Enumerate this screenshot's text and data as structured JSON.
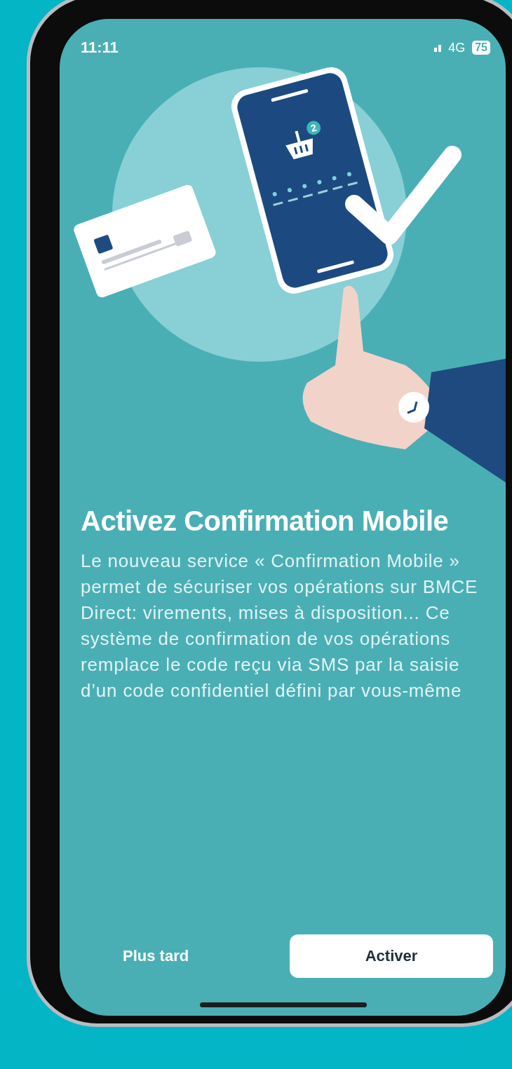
{
  "status_bar": {
    "time": "11:11",
    "network": "4G",
    "battery": "75"
  },
  "illustration": {
    "badge": "2"
  },
  "title": "Activez Confirmation Mobile",
  "description": "Le nouveau service « Confirmation Mobile » permet de sécuriser vos opérations sur BMCE Direct: virements, mises à disposition... Ce système de confirmation de vos opérations remplace le code reçu via SMS par la saisie d’un code confidentiel défini par vous-même",
  "buttons": [
    {
      "label": "Plus tard",
      "kind": "text"
    },
    {
      "label": "Activer",
      "kind": "filled"
    }
  ]
}
